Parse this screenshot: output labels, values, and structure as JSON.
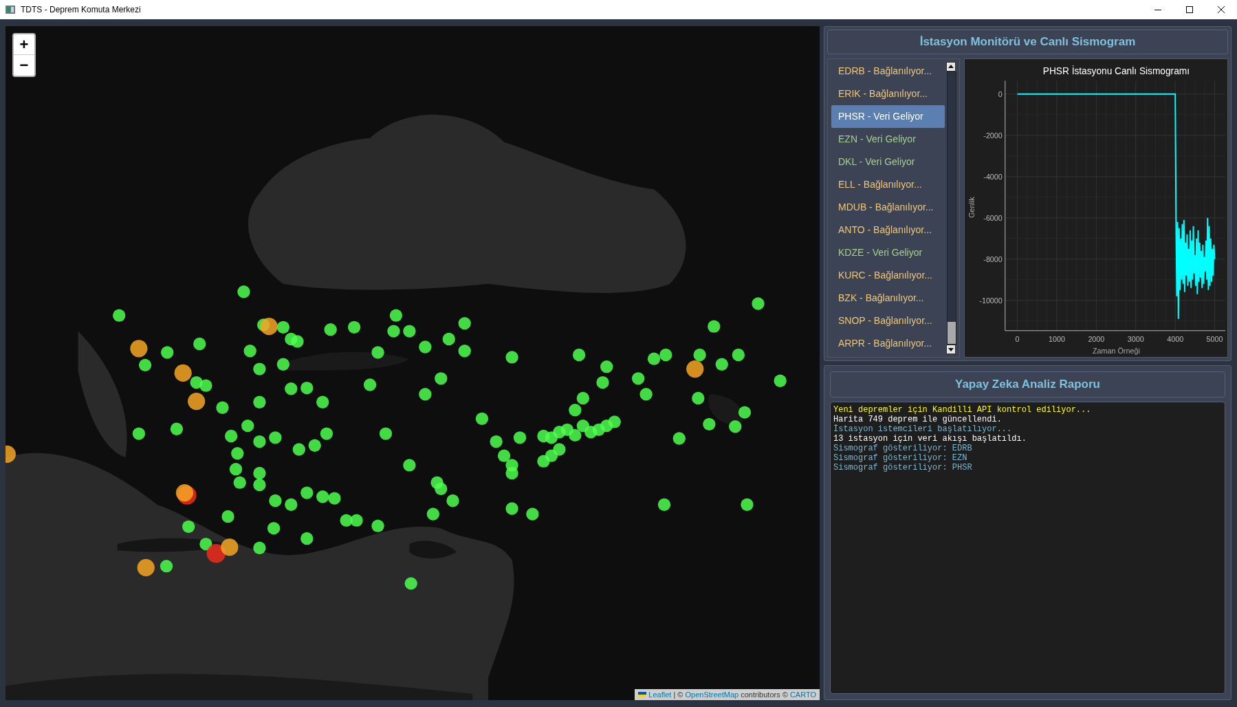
{
  "window": {
    "title": "TDTS - Deprem Komuta Merkezi"
  },
  "map": {
    "zoom_in": "+",
    "zoom_out": "−",
    "attribution": {
      "flag": "Leaflet",
      "links": [
        {
          "text": "OpenStreetMap",
          "kind": "link"
        },
        {
          "text": " contributors © ",
          "kind": "plain"
        },
        {
          "text": "CARTO",
          "kind": "link"
        }
      ],
      "separator": " | © "
    }
  },
  "monitor": {
    "title": "İstasyon Monitörü ve Canlı Sismogram",
    "stations": [
      {
        "label": "EDRB - Bağlanılıyor...",
        "kind": "connecting",
        "selected": false
      },
      {
        "label": "ERIK - Bağlanılıyor...",
        "kind": "connecting",
        "selected": false
      },
      {
        "label": "PHSR - Veri Geliyor",
        "kind": "streaming",
        "selected": true
      },
      {
        "label": "EZN - Veri Geliyor",
        "kind": "streaming",
        "selected": false
      },
      {
        "label": "DKL - Veri Geliyor",
        "kind": "streaming",
        "selected": false
      },
      {
        "label": "ELL - Bağlanılıyor...",
        "kind": "connecting",
        "selected": false
      },
      {
        "label": "MDUB - Bağlanılıyor...",
        "kind": "connecting",
        "selected": false
      },
      {
        "label": "ANTO - Bağlanılıyor...",
        "kind": "connecting",
        "selected": false
      },
      {
        "label": "KDZE - Veri Geliyor",
        "kind": "streaming",
        "selected": false
      },
      {
        "label": "KURC - Bağlanılıyor...",
        "kind": "connecting",
        "selected": false
      },
      {
        "label": "BZK - Bağlanılıyor...",
        "kind": "connecting",
        "selected": false
      },
      {
        "label": "SNOP - Bağlanılıyor...",
        "kind": "connecting",
        "selected": false
      },
      {
        "label": "ARPR - Bağlanılıyor...",
        "kind": "connecting",
        "selected": false
      }
    ],
    "seismogram": {
      "chart_data": {
        "type": "line",
        "title": "PHSR İstasyonu Canlı Sismogramı",
        "xlabel": "Zaman Örneği",
        "ylabel": "Genlik",
        "grid": true,
        "xlim": [
          -310,
          5270
        ],
        "ylim": [
          -11470,
          650
        ],
        "xticks": [
          0,
          1000,
          2000,
          3000,
          4000,
          5000
        ],
        "yticks": [
          0,
          -2000,
          -4000,
          -6000,
          -8000,
          -10000
        ],
        "x": [
          0,
          3990,
          4000,
          4020,
          4040,
          4060,
          4080,
          4100,
          4120,
          4140,
          4160,
          4180,
          4200,
          4220,
          4240,
          4260,
          4280,
          4300,
          4320,
          4340,
          4360,
          4380,
          4400,
          4420,
          4440,
          4460,
          4480,
          4500,
          4520,
          4540,
          4560,
          4580,
          4600,
          4620,
          4640,
          4660,
          4680,
          4700,
          4720,
          4740,
          4760,
          4780,
          4800,
          4820,
          4840,
          4860,
          4880,
          4900,
          4920,
          4940,
          4960,
          4980,
          5000
        ],
        "series": [
          {
            "color": "#00ffff",
            "values": [
              0,
              0,
              0,
              -5800,
              -9800,
              -6200,
              -10900,
              -6500,
              -9500,
              -7000,
              -9000,
              -6300,
              -9200,
              -6100,
              -9600,
              -7200,
              -8800,
              -6800,
              -9300,
              -7500,
              -9100,
              -6600,
              -9400,
              -7100,
              -9000,
              -6400,
              -8700,
              -7800,
              -9300,
              -7000,
              -9700,
              -6600,
              -9100,
              -7200,
              -8900,
              -7600,
              -9400,
              -7300,
              -9200,
              -7900,
              -8600,
              -7100,
              -9000,
              -6000,
              -9500,
              -6400,
              -9300,
              -7000,
              -9100,
              -7500,
              -8800,
              -7300,
              -8000
            ]
          }
        ]
      }
    }
  },
  "report": {
    "title": "Yapay Zeka Analiz Raporu",
    "log": [
      {
        "text": "Yeni depremler için Kandilli API kontrol ediliyor...",
        "color": "#ffff00"
      },
      {
        "text": "Harita 749 deprem ile güncellendi.",
        "color": "#ffffff"
      },
      {
        "text": "İstasyon istemcileri başlatılıyor...",
        "color": "#7fb6cf"
      },
      {
        "text": "13 istasyon için veri akışı başlatıldı.",
        "color": "#ffffff"
      },
      {
        "text": "Sismograf gösteriliyor: EDRB",
        "color": "#7fb6cf"
      },
      {
        "text": "Sismograf gösteriliyor: EZN",
        "color": "#7fb6cf"
      },
      {
        "text": "Sismograf gösteriliyor: PHSR",
        "color": "#7fb6cf"
      }
    ]
  }
}
